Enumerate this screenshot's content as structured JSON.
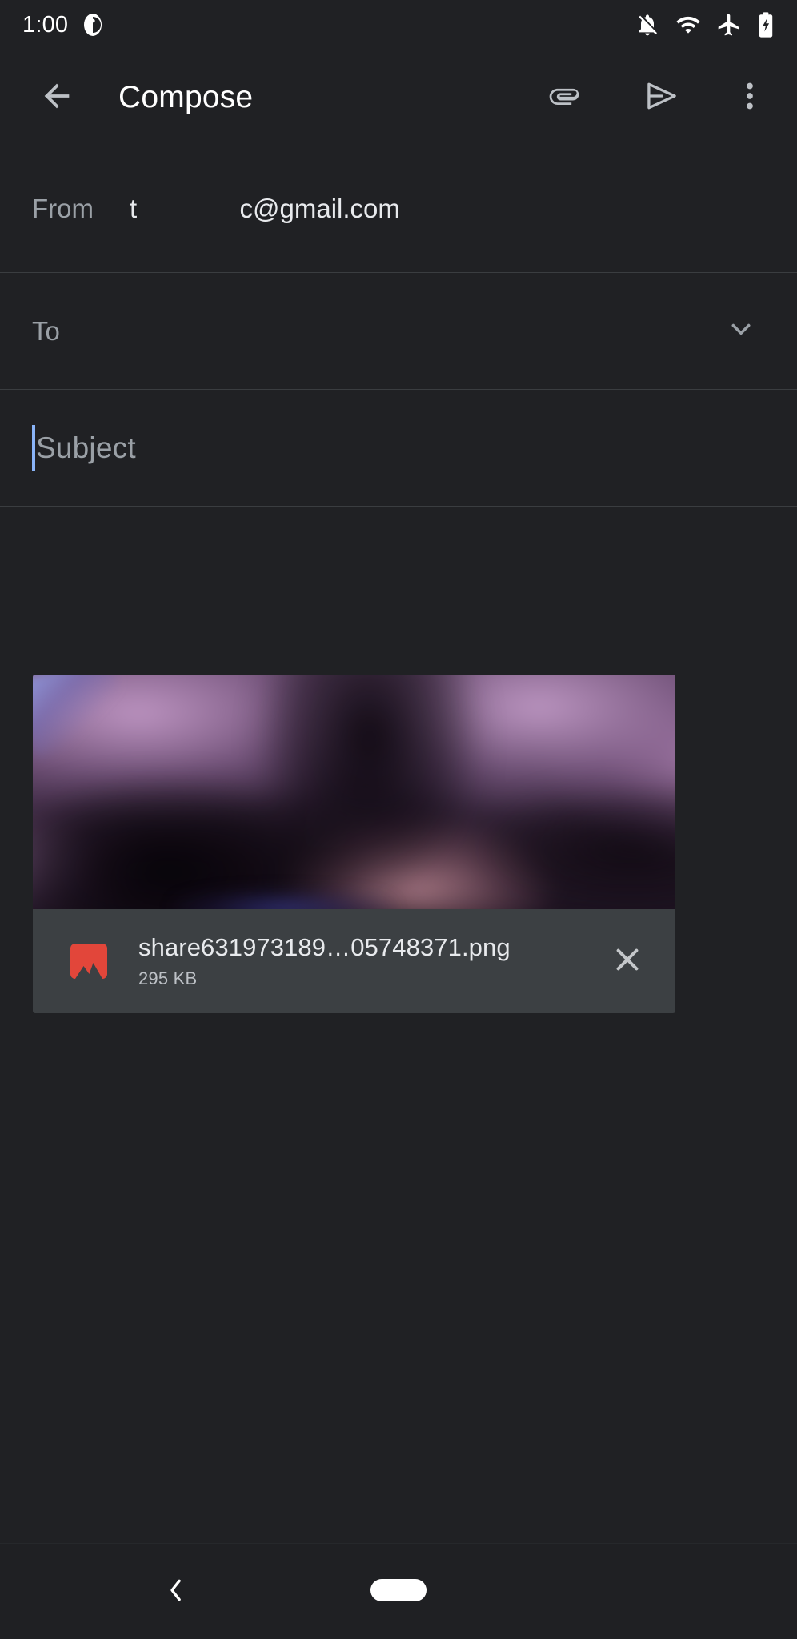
{
  "status_bar": {
    "time": "1:00",
    "left_icons": [
      {
        "name": "clock-app-icon"
      }
    ],
    "right_icons": [
      {
        "name": "notifications-off-icon"
      },
      {
        "name": "wifi-icon"
      },
      {
        "name": "airplane-mode-icon"
      },
      {
        "name": "battery-charging-icon"
      }
    ]
  },
  "app_bar": {
    "back_label": "Back",
    "title": "Compose",
    "attach_label": "Attach file",
    "send_label": "Send",
    "more_label": "More options"
  },
  "fields": {
    "from": {
      "label": "From",
      "value": "t              c@gmail.com"
    },
    "to": {
      "placeholder": "To",
      "value": "",
      "expand_label": "Show Cc/Bcc"
    },
    "subject": {
      "placeholder": "Subject",
      "value": ""
    }
  },
  "attachment": {
    "file_name": "share631973189…05748371.png",
    "file_size": "295 KB",
    "file_type": "png",
    "remove_label": "Remove attachment"
  },
  "nav_bar": {
    "back_label": "Back",
    "home_label": "Home"
  },
  "colors": {
    "background": "#202124",
    "surface": "#3c4043",
    "divider": "#3a3d40",
    "text_primary": "#e8eaed",
    "text_secondary": "#9aa0a6",
    "icon": "#bdc1c6",
    "caret": "#8ab4f8",
    "file_icon": "#e2463a"
  }
}
